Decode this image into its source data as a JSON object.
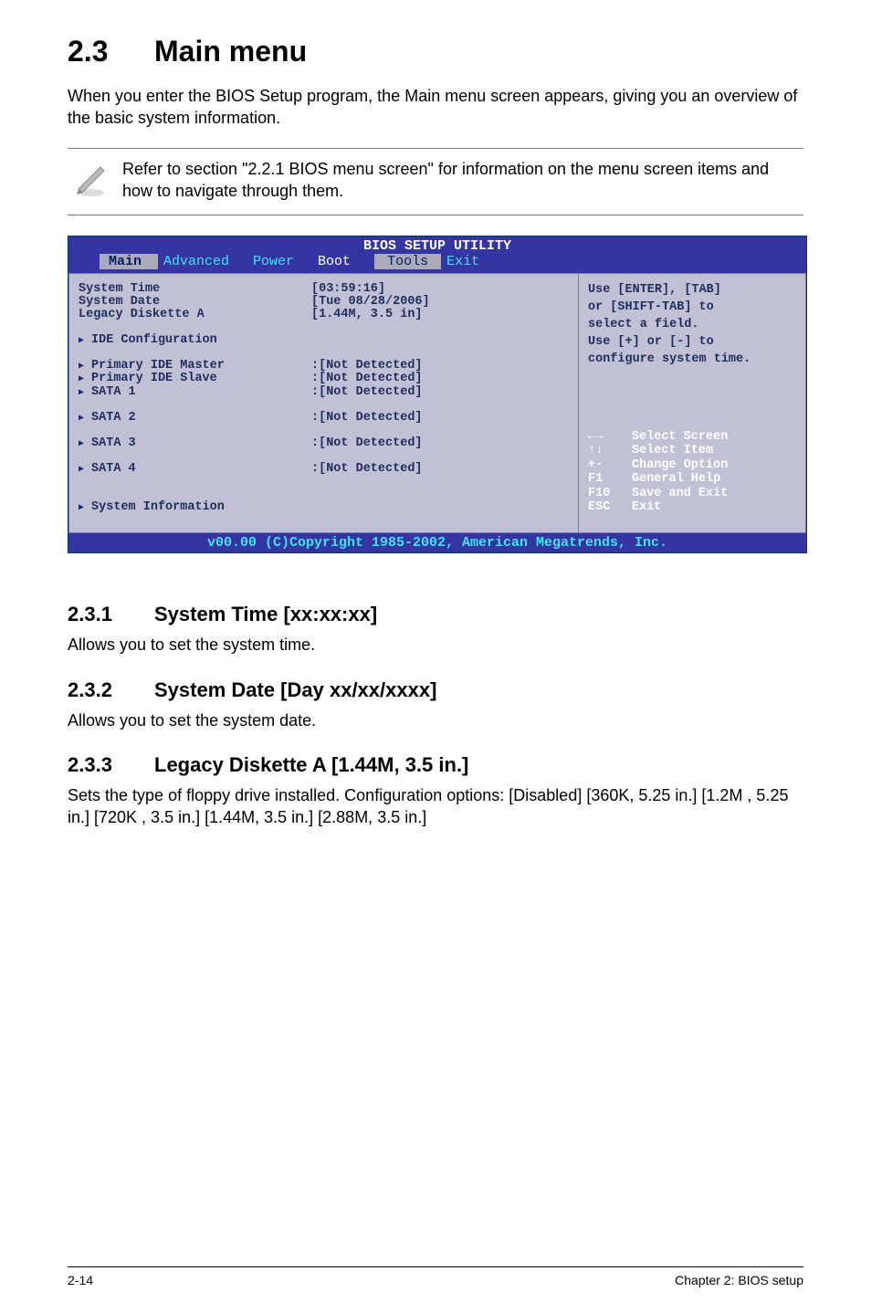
{
  "section": {
    "number": "2.3",
    "title": "Main menu",
    "intro": "When you enter the BIOS Setup program, the Main menu screen appears, giving you an overview of the basic system information."
  },
  "note": {
    "text": "Refer to section \"2.2.1  BIOS menu screen\" for information on the menu screen items and how to navigate through them."
  },
  "bios": {
    "title": "BIOS SETUP UTILITY",
    "tabs": [
      "Main",
      "Advanced",
      "Power",
      "Boot",
      "Tools",
      "Exit"
    ],
    "left_rows": [
      {
        "type": "row",
        "label": "System Time",
        "value": "[03:59:16]"
      },
      {
        "type": "row",
        "label": "System Date",
        "value": "[Tue 08/28/2006]"
      },
      {
        "type": "row",
        "label": "Legacy Diskette A",
        "value": "[1.44M, 3.5 in]"
      },
      {
        "type": "gap"
      },
      {
        "type": "sub",
        "label": "IDE Configuration",
        "value": ""
      },
      {
        "type": "gap"
      },
      {
        "type": "sub",
        "label": "Primary IDE Master",
        "value": ":[Not Detected]"
      },
      {
        "type": "sub",
        "label": "Primary IDE Slave",
        "value": ":[Not Detected]"
      },
      {
        "type": "sub",
        "label": "SATA 1",
        "value": ":[Not Detected]"
      },
      {
        "type": "gap"
      },
      {
        "type": "sub",
        "label": "SATA 2",
        "value": ":[Not Detected]"
      },
      {
        "type": "gap"
      },
      {
        "type": "sub",
        "label": "SATA 3",
        "value": ":[Not Detected]"
      },
      {
        "type": "gap"
      },
      {
        "type": "sub",
        "label": "SATA 4",
        "value": ":[Not Detected]"
      },
      {
        "type": "gap"
      },
      {
        "type": "gap"
      },
      {
        "type": "sub",
        "label": "System Information",
        "value": ""
      }
    ],
    "help": [
      "Use [ENTER], [TAB]",
      "or [SHIFT-TAB] to",
      "select a field.",
      "",
      "Use [+] or [-] to",
      "configure system time."
    ],
    "legend": [
      {
        "key": "←→",
        "text": "Select Screen"
      },
      {
        "key": "↑↓",
        "text": "Select Item"
      },
      {
        "key": "+-",
        "text": "Change Option"
      },
      {
        "key": "F1",
        "text": "General Help"
      },
      {
        "key": "F10",
        "text": "Save and Exit"
      },
      {
        "key": "ESC",
        "text": "Exit"
      }
    ],
    "footer": "v00.00 (C)Copyright 1985-2002, American Megatrends, Inc."
  },
  "subsections": [
    {
      "num": "2.3.1",
      "title": "System Time [xx:xx:xx]",
      "body": "Allows you to set the system time."
    },
    {
      "num": "2.3.2",
      "title": "System Date [Day xx/xx/xxxx]",
      "body": "Allows you to set the system date."
    },
    {
      "num": "2.3.3",
      "title": "Legacy Diskette A [1.44M, 3.5 in.]",
      "body": "Sets the type of floppy drive installed. Configuration options: [Disabled] [360K, 5.25 in.] [1.2M , 5.25 in.] [720K , 3.5 in.] [1.44M, 3.5 in.] [2.88M, 3.5 in.]"
    }
  ],
  "footer": {
    "left": "2-14",
    "right": "Chapter 2: BIOS setup"
  }
}
